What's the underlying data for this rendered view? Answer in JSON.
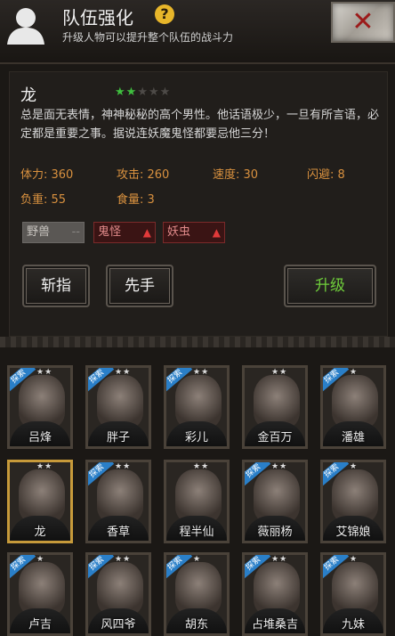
{
  "header": {
    "title": "队伍强化",
    "subtitle": "升级人物可以提升整个队伍的战斗力",
    "help_glyph": "?",
    "close_glyph": "✕"
  },
  "hero": {
    "name": "龙",
    "stars": 2,
    "max_stars": 5,
    "description": "总是面无表情，神神秘秘的高个男性。他话语极少，一旦有所言语，必定都是重要之事。据说连妖魔鬼怪都要忌他三分！",
    "stats": {
      "hp": "体力: 360",
      "attack": "攻击: 260",
      "speed": "速度: 30",
      "dodge": "闪避: 8",
      "load": "负重: 55",
      "food": "食量: 3"
    },
    "tags": {
      "beast": "野兽",
      "ghost": "鬼怪",
      "demon": "妖虫"
    }
  },
  "buttons": {
    "slash": "斩指",
    "first": "先手",
    "upgrade": "升级"
  },
  "roster": [
    {
      "name": "吕烽",
      "badge": "探索",
      "stars": "★★"
    },
    {
      "name": "胖子",
      "badge": "探索",
      "stars": "★★"
    },
    {
      "name": "彩儿",
      "badge": "探索",
      "stars": "★★"
    },
    {
      "name": "金百万",
      "badge": "",
      "stars": "★★"
    },
    {
      "name": "潘雄",
      "badge": "探索",
      "stars": "★"
    },
    {
      "name": "龙",
      "badge": "",
      "stars": "★★"
    },
    {
      "name": "香草",
      "badge": "探索",
      "stars": "★★"
    },
    {
      "name": "程半仙",
      "badge": "",
      "stars": "★★"
    },
    {
      "name": "薇丽杨",
      "badge": "探索",
      "stars": "★★"
    },
    {
      "name": "艾锦娘",
      "badge": "探索",
      "stars": "★"
    },
    {
      "name": "卢吉",
      "badge": "探索",
      "stars": "★"
    },
    {
      "name": "风四爷",
      "badge": "探索",
      "stars": "★★"
    },
    {
      "name": "胡东",
      "badge": "探索",
      "stars": "★"
    },
    {
      "name": "占堆桑吉",
      "badge": "探索",
      "stars": "★★"
    },
    {
      "name": "九妹",
      "badge": "探索",
      "stars": "★"
    }
  ]
}
